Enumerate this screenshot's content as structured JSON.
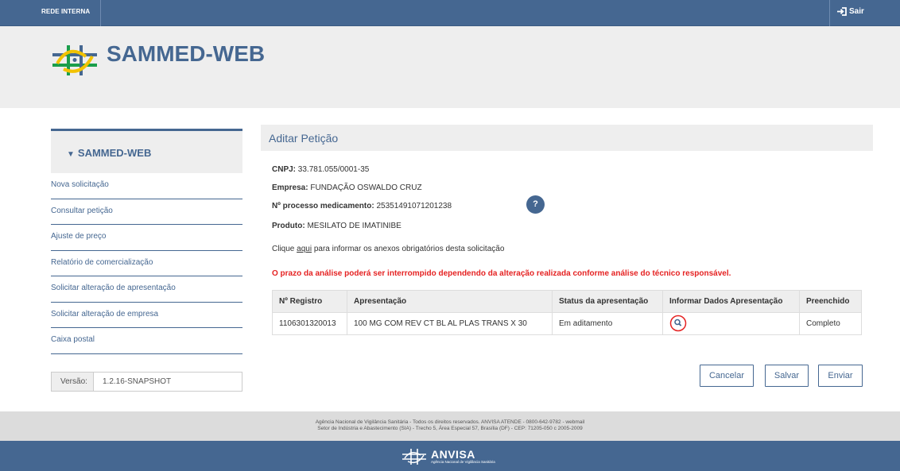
{
  "topbar": {
    "rede_label": "REDE INTERNA",
    "sair_label": "Sair"
  },
  "header": {
    "title": "SAMMED-WEB"
  },
  "sidebar": {
    "title": "SAMMED-WEB",
    "items": [
      {
        "label": "Nova solicitação"
      },
      {
        "label": "Consultar petição"
      },
      {
        "label": "Ajuste de preço"
      },
      {
        "label": "Relatório de comercialização"
      },
      {
        "label": "Solicitar alteração de apresentação"
      },
      {
        "label": "Solicitar alteração de empresa"
      },
      {
        "label": "Caixa postal"
      }
    ]
  },
  "versao": {
    "label": "Versão:",
    "value": "1.2.16-SNAPSHOT"
  },
  "main": {
    "title": "Aditar Petição",
    "cnpj_label": "CNPJ:",
    "cnpj": "33.781.055/0001-35",
    "empresa_label": "Empresa:",
    "empresa": "FUNDAÇÃO OSWALDO CRUZ",
    "processo_label": "Nº processo medicamento:",
    "processo": "25351491071201238",
    "produto_label": "Produto:",
    "produto": "MESILATO DE IMATINIBE",
    "clique_pre": "Clique",
    "clique_link": "aqui",
    "clique_post": "para informar os anexos obrigatórios desta solicitação",
    "warning": "O prazo da análise poderá ser interrompido dependendo da alteração realizada conforme análise do técnico responsável.",
    "help_label": "?"
  },
  "table": {
    "headers": [
      "Nº Registro",
      "Apresentação",
      "Status da apresentação",
      "Informar Dados Apresentação",
      "Preenchido"
    ],
    "rows": [
      {
        "registro": "1106301320013",
        "apresentacao": "100 MG COM REV CT BL AL PLAS TRANS X 30",
        "status": "Em aditamento",
        "preenchido": "Completo"
      }
    ]
  },
  "buttons": {
    "cancelar": "Cancelar",
    "salvar": "Salvar",
    "enviar": "Enviar"
  },
  "footer": {
    "line1": "Agência Nacional de Vigilância Sanitária - Todos os direitos reservados. ANVISA ATENDE - 0800-642-9782 - webmail",
    "line2": "Setor de Indústria e Abastecimento (SIA) - Trecho 5, Área Especial 57, Brasília (DF) - CEP: 71205-050 c 2005-2009"
  },
  "brand": {
    "name": "ANVISA",
    "tagline": "Agência Nacional de Vigilância Sanitária"
  },
  "colors": {
    "primary": "#456791",
    "warning": "#e52222",
    "header_bg": "#eeeeee"
  }
}
